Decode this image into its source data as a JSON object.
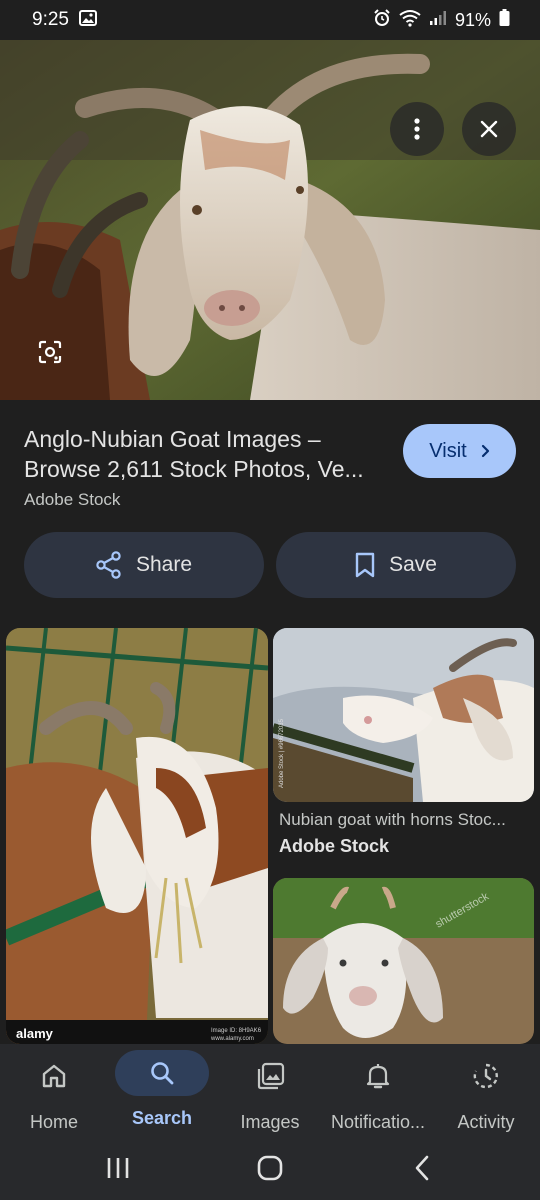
{
  "status_bar": {
    "time": "9:25",
    "battery": "91%"
  },
  "result": {
    "title_line1": "Anglo-Nubian Goat Images –",
    "title_line2": "Browse 2,611 Stock Photos, Ve...",
    "source": "Adobe Stock",
    "visit_label": "Visit",
    "share_label": "Share",
    "save_label": "Save"
  },
  "related": [
    {
      "watermark": "alamy",
      "image_id": "Image ID: 8H9AK6",
      "site": "www.alamy.com"
    },
    {
      "caption": "Nubian goat with horns Stoc...",
      "source": "Adobe Stock",
      "side_text": "Adobe Stock | #96672035"
    },
    {
      "watermark": "shutterstock"
    }
  ],
  "bottom_nav": [
    {
      "label": "Home",
      "icon": "home-icon",
      "active": false
    },
    {
      "label": "Search",
      "icon": "search-icon",
      "active": true
    },
    {
      "label": "Images",
      "icon": "images-icon",
      "active": false
    },
    {
      "label": "Notificatio...",
      "icon": "bell-icon",
      "active": false
    },
    {
      "label": "Activity",
      "icon": "activity-icon",
      "active": false
    }
  ],
  "colors": {
    "background": "#1f1f1f",
    "accent": "#a8c7fa",
    "action_button": "#2e3441",
    "nav_bar": "#28292c"
  }
}
